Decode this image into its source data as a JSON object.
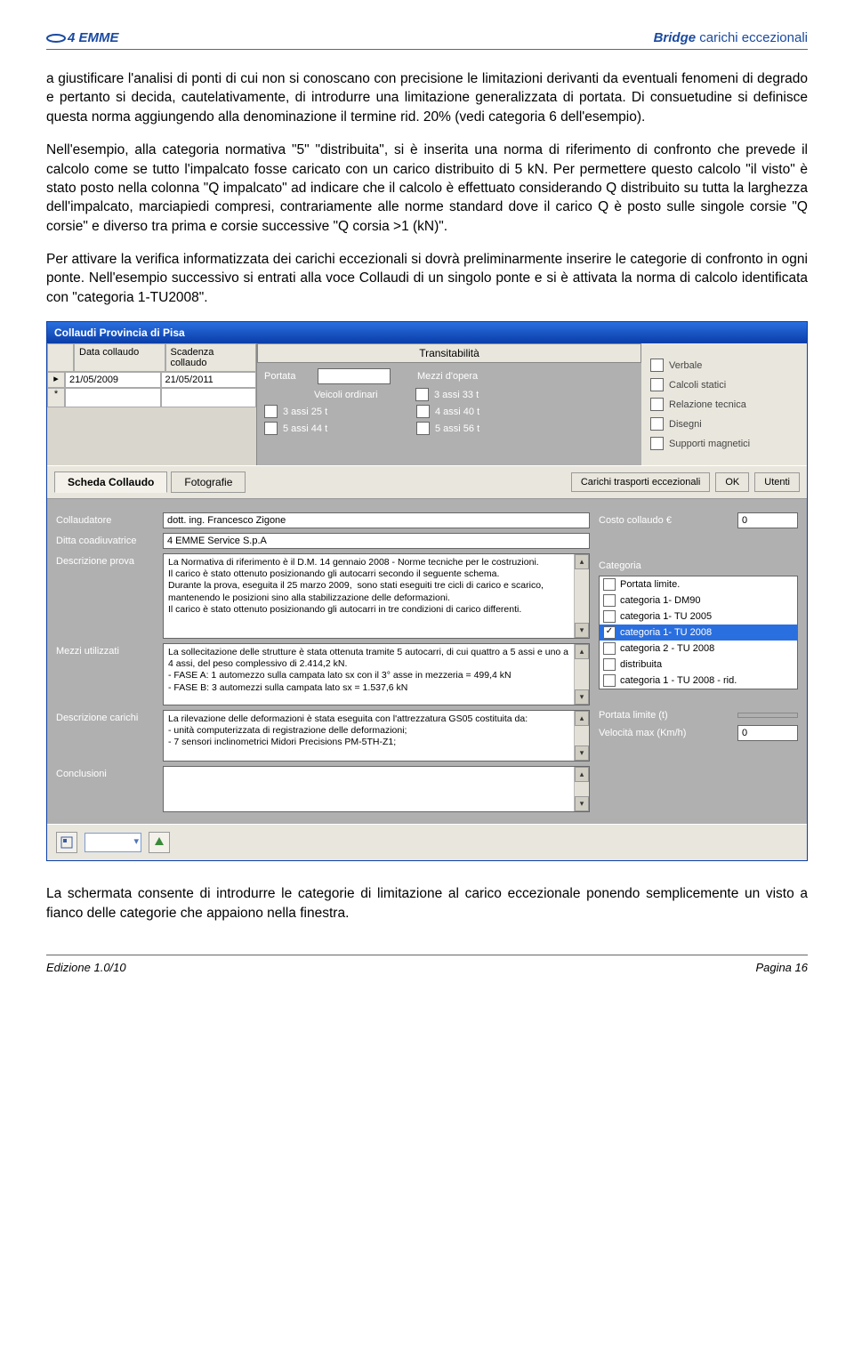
{
  "header": {
    "logo_text": "4 EMME",
    "title_bold": "Bridge",
    "title_rest": " carichi eccezionali"
  },
  "paragraphs": {
    "p1": "a giustificare l'analisi di ponti di cui non si conoscano con precisione le limitazioni derivanti da eventuali fenomeni di degrado e pertanto si decida, cautelativamente, di introdurre una limitazione generalizzata di portata. Di consuetudine si definisce questa norma aggiungendo alla denominazione il termine rid. 20% (vedi categoria 6 dell'esempio).",
    "p2": "Nell'esempio, alla categoria normativa \"5\" \"distribuita\", si è inserita una norma di riferimento di confronto che prevede il calcolo come se tutto l'impalcato fosse caricato con un carico distribuito di 5 kN. Per permettere questo calcolo \"il visto\" è stato posto nella colonna \"Q impalcato\" ad indicare che il calcolo è effettuato considerando Q distribuito su tutta la larghezza dell'impalcato, marciapiedi compresi, contrariamente alle norme standard dove il carico Q è posto sulle singole corsie \"Q corsie\" e diverso tra prima e corsie successive \"Q corsia >1 (kN)\".",
    "p3": "Per attivare la verifica informatizzata dei carichi eccezionali si dovrà preliminarmente inserire le categorie di confronto in ogni ponte. Nell'esempio successivo si entrati alla voce Collaudi di un singolo ponte e si è attivata la norma di calcolo identificata con \"categoria 1-TU2008\".",
    "p4": "La schermata consente di introdurre le categorie di limitazione al carico eccezionale ponendo semplicemente un visto a fianco delle categorie che appaiono nella finestra."
  },
  "window": {
    "title": "Collaudi   Provincia di Pisa",
    "dates": {
      "h1": "Data collaudo",
      "h2": "Scadenza collaudo",
      "r1c1": "21/05/2009",
      "r1c2": "21/05/2011"
    },
    "trans": {
      "title": "Transitabilità",
      "portata": "Portata",
      "mezzi": "Mezzi d'opera",
      "veicoli": "Veicoli ordinari",
      "c1": "3 assi  33 t",
      "c2": "3 assi  25 t",
      "c3": "4 assi  40 t",
      "c4": "5 assi  44 t",
      "c5": "5 assi  56 t"
    },
    "docs": {
      "d1": "Verbale",
      "d2": "Calcoli statici",
      "d3": "Relazione tecnica",
      "d4": "Disegni",
      "d5": "Supporti magnetici"
    },
    "tabs": {
      "t1": "Scheda Collaudo",
      "t2": "Fotografie",
      "b1": "Carichi trasporti eccezionali",
      "b2": "OK",
      "b3": "Utenti"
    },
    "form": {
      "l_collaudatore": "Collaudatore",
      "v_collaudatore": "dott. ing. Francesco Zigone",
      "l_ditta": "Ditta coadiuvatrice",
      "v_ditta": "4 EMME Service S.p.A",
      "l_descr_prova": "Descrizione prova",
      "v_descr_prova": "La Normativa di riferimento è il D.M. 14 gennaio 2008 - Norme tecniche per le costruzioni.\nIl carico è stato ottenuto posizionando gli autocarri secondo il seguente schema.\nDurante la prova, eseguita il 25 marzo 2009,  sono stati eseguiti tre cicli di carico e scarico, mantenendo le posizioni sino alla stabilizzazione delle deformazioni.\nIl carico è stato ottenuto posizionando gli autocarri in tre condizioni di carico differenti.",
      "l_mezzi": "Mezzi utilizzati",
      "v_mezzi": "La sollecitazione delle strutture è stata ottenuta tramite 5 autocarri, di cui quattro a 5 assi e uno a 4 assi, del peso complessivo di 2.414,2 kN.\n- FASE A: 1 automezzo sulla campata lato sx con il 3° asse in mezzeria = 499,4 kN\n- FASE B: 3 automezzi sulla campata lato sx = 1.537,6 kN",
      "l_descr_carichi": "Descrizione carichi",
      "v_descr_carichi": "La rilevazione delle deformazioni è stata eseguita con l'attrezzatura GS05 costituita da:\n- unità computerizzata di registrazione delle deformazioni;\n- 7 sensori inclinometrici Midori Precisions PM-5TH-Z1;",
      "l_conclusioni": "Conclusioni",
      "l_costo": "Costo collaudo €",
      "v_costo": "0",
      "l_categoria": "Categoria",
      "cats": {
        "c0": "Portata limite.",
        "c1": "categoria 1- DM90",
        "c2": "categoria 1- TU 2005",
        "c3": "categoria 1- TU 2008",
        "c4": "categoria 2 - TU 2008",
        "c5": "distribuita",
        "c6": "categoria 1 - TU 2008 - rid."
      },
      "l_portata_lim": "Portata limite (t)",
      "l_velocita": "Velocità max (Km/h)",
      "v_velocita": "0"
    }
  },
  "footer": {
    "left": "Edizione 1.0/10",
    "right": "Pagina 16"
  }
}
